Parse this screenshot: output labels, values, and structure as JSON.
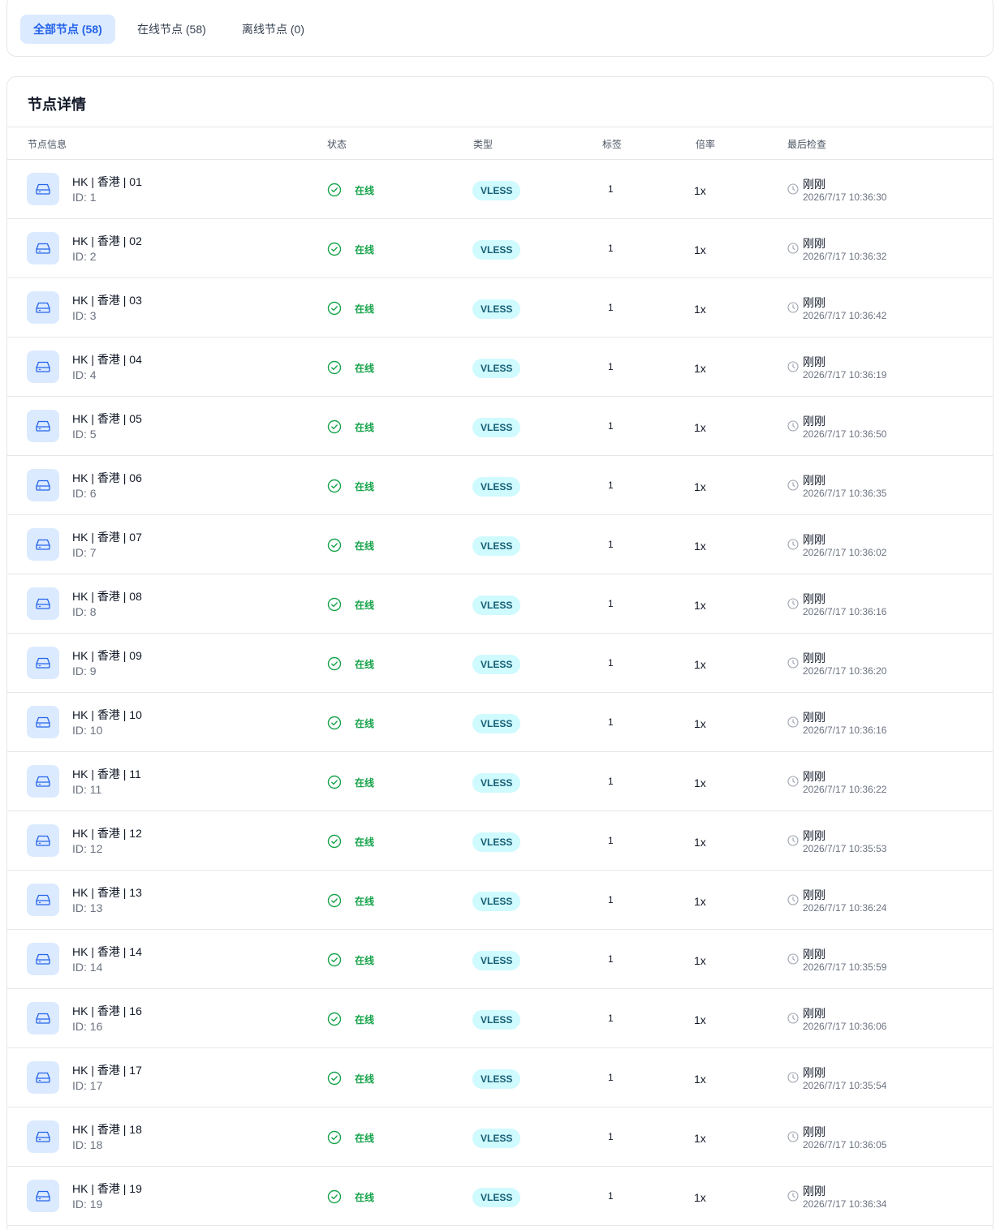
{
  "filters": [
    {
      "label": "全部节点 (58)",
      "active": true
    },
    {
      "label": "在线节点 (58)",
      "active": false
    },
    {
      "label": "离线节点 (0)",
      "active": false
    }
  ],
  "detail": {
    "title": "节点详情",
    "columns": [
      "节点信息",
      "状态",
      "类型",
      "标签",
      "倍率",
      "最后检查"
    ]
  },
  "nodes": [
    {
      "name": "HK | 香港 | 01",
      "id": "ID: 1",
      "status": "在线",
      "type": "VLESS",
      "tags": "1",
      "rate": "1x",
      "checked_rel": "刚刚",
      "checked_time": "2026/7/17 10:36:30"
    },
    {
      "name": "HK | 香港 | 02",
      "id": "ID: 2",
      "status": "在线",
      "type": "VLESS",
      "tags": "1",
      "rate": "1x",
      "checked_rel": "刚刚",
      "checked_time": "2026/7/17 10:36:32"
    },
    {
      "name": "HK | 香港 | 03",
      "id": "ID: 3",
      "status": "在线",
      "type": "VLESS",
      "tags": "1",
      "rate": "1x",
      "checked_rel": "刚刚",
      "checked_time": "2026/7/17 10:36:42"
    },
    {
      "name": "HK | 香港 | 04",
      "id": "ID: 4",
      "status": "在线",
      "type": "VLESS",
      "tags": "1",
      "rate": "1x",
      "checked_rel": "刚刚",
      "checked_time": "2026/7/17 10:36:19"
    },
    {
      "name": "HK | 香港 | 05",
      "id": "ID: 5",
      "status": "在线",
      "type": "VLESS",
      "tags": "1",
      "rate": "1x",
      "checked_rel": "刚刚",
      "checked_time": "2026/7/17 10:36:50"
    },
    {
      "name": "HK | 香港 | 06",
      "id": "ID: 6",
      "status": "在线",
      "type": "VLESS",
      "tags": "1",
      "rate": "1x",
      "checked_rel": "刚刚",
      "checked_time": "2026/7/17 10:36:35"
    },
    {
      "name": "HK | 香港 | 07",
      "id": "ID: 7",
      "status": "在线",
      "type": "VLESS",
      "tags": "1",
      "rate": "1x",
      "checked_rel": "刚刚",
      "checked_time": "2026/7/17 10:36:02"
    },
    {
      "name": "HK | 香港 | 08",
      "id": "ID: 8",
      "status": "在线",
      "type": "VLESS",
      "tags": "1",
      "rate": "1x",
      "checked_rel": "刚刚",
      "checked_time": "2026/7/17 10:36:16"
    },
    {
      "name": "HK | 香港 | 09",
      "id": "ID: 9",
      "status": "在线",
      "type": "VLESS",
      "tags": "1",
      "rate": "1x",
      "checked_rel": "刚刚",
      "checked_time": "2026/7/17 10:36:20"
    },
    {
      "name": "HK | 香港 | 10",
      "id": "ID: 10",
      "status": "在线",
      "type": "VLESS",
      "tags": "1",
      "rate": "1x",
      "checked_rel": "刚刚",
      "checked_time": "2026/7/17 10:36:16"
    },
    {
      "name": "HK | 香港 | 11",
      "id": "ID: 11",
      "status": "在线",
      "type": "VLESS",
      "tags": "1",
      "rate": "1x",
      "checked_rel": "刚刚",
      "checked_time": "2026/7/17 10:36:22"
    },
    {
      "name": "HK | 香港 | 12",
      "id": "ID: 12",
      "status": "在线",
      "type": "VLESS",
      "tags": "1",
      "rate": "1x",
      "checked_rel": "刚刚",
      "checked_time": "2026/7/17 10:35:53"
    },
    {
      "name": "HK | 香港 | 13",
      "id": "ID: 13",
      "status": "在线",
      "type": "VLESS",
      "tags": "1",
      "rate": "1x",
      "checked_rel": "刚刚",
      "checked_time": "2026/7/17 10:36:24"
    },
    {
      "name": "HK | 香港 | 14",
      "id": "ID: 14",
      "status": "在线",
      "type": "VLESS",
      "tags": "1",
      "rate": "1x",
      "checked_rel": "刚刚",
      "checked_time": "2026/7/17 10:35:59"
    },
    {
      "name": "HK | 香港 | 16",
      "id": "ID: 16",
      "status": "在线",
      "type": "VLESS",
      "tags": "1",
      "rate": "1x",
      "checked_rel": "刚刚",
      "checked_time": "2026/7/17 10:36:06"
    },
    {
      "name": "HK | 香港 | 17",
      "id": "ID: 17",
      "status": "在线",
      "type": "VLESS",
      "tags": "1",
      "rate": "1x",
      "checked_rel": "刚刚",
      "checked_time": "2026/7/17 10:35:54"
    },
    {
      "name": "HK | 香港 | 18",
      "id": "ID: 18",
      "status": "在线",
      "type": "VLESS",
      "tags": "1",
      "rate": "1x",
      "checked_rel": "刚刚",
      "checked_time": "2026/7/17 10:36:05"
    },
    {
      "name": "HK | 香港 | 19",
      "id": "ID: 19",
      "status": "在线",
      "type": "VLESS",
      "tags": "1",
      "rate": "1x",
      "checked_rel": "刚刚",
      "checked_time": "2026/7/17 10:36:34"
    }
  ],
  "icons": {
    "node": "server-icon",
    "status": "check-circle-icon",
    "time": "clock-icon"
  },
  "colors": {
    "accent": "#2563eb",
    "accent_bg": "#dbeafe",
    "online": "#16a34a",
    "badge_bg": "#cffafe",
    "badge_text": "#155e75"
  }
}
